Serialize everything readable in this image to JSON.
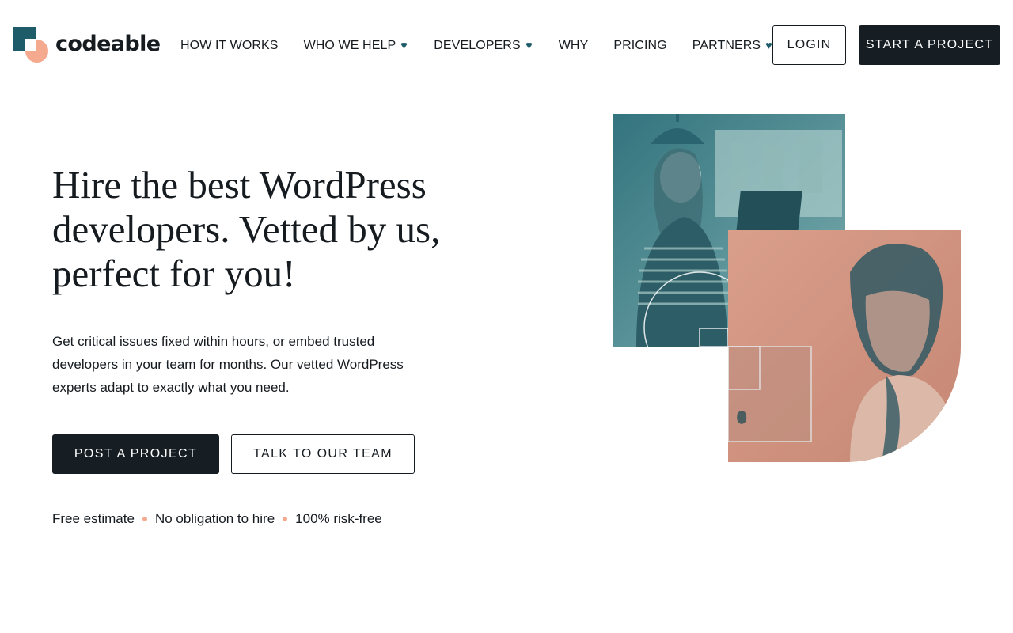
{
  "brand": {
    "name": "codeable"
  },
  "nav": {
    "items": [
      {
        "label": "HOW IT WORKS",
        "dropdown": false
      },
      {
        "label": "WHO WE HELP",
        "dropdown": true
      },
      {
        "label": "DEVELOPERS",
        "dropdown": true
      },
      {
        "label": "WHY",
        "dropdown": false
      },
      {
        "label": "PRICING",
        "dropdown": false
      },
      {
        "label": "PARTNERS",
        "dropdown": true
      }
    ],
    "login_label": "LOGIN",
    "start_label": "START A PROJECT"
  },
  "hero": {
    "title": "Hire the best WordPress developers. Vetted by us, perfect for you!",
    "description": "Get critical issues fixed within hours, or embed trusted developers in your team for months. Our vetted WordPress experts adapt to exactly what you need.",
    "primary_cta": "POST A PROJECT",
    "secondary_cta": "TALK TO OUR TEAM",
    "assurances": [
      "Free estimate",
      "No obligation to hire",
      "100% risk-free"
    ]
  },
  "colors": {
    "brand_teal": "#1f5c6a",
    "brand_peach": "#f5a98f",
    "ink": "#161b20"
  },
  "icons": {
    "dropdown": "chevron-down-icon"
  }
}
